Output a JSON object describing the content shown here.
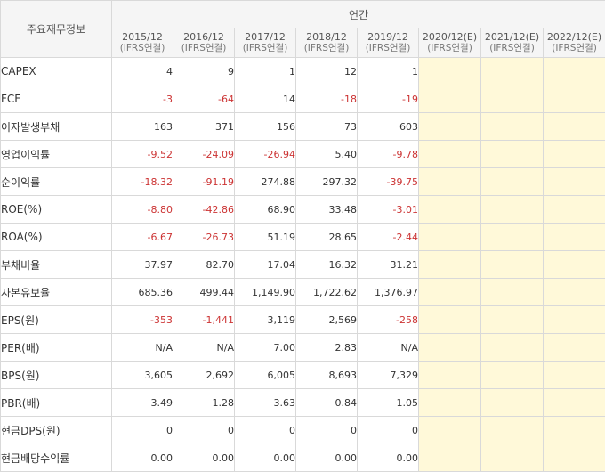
{
  "table": {
    "corner_label": "주요재무정보",
    "group_label": "연간",
    "periods": [
      {
        "year": "2015/12",
        "basis": "(IFRS연결)",
        "estimate": false
      },
      {
        "year": "2016/12",
        "basis": "(IFRS연결)",
        "estimate": false
      },
      {
        "year": "2017/12",
        "basis": "(IFRS연결)",
        "estimate": false
      },
      {
        "year": "2018/12",
        "basis": "(IFRS연결)",
        "estimate": false
      },
      {
        "year": "2019/12",
        "basis": "(IFRS연결)",
        "estimate": false
      },
      {
        "year": "2020/12(E)",
        "basis": "(IFRS연결)",
        "estimate": true
      },
      {
        "year": "2021/12(E)",
        "basis": "(IFRS연결)",
        "estimate": true
      },
      {
        "year": "2022/12(E)",
        "basis": "(IFRS연결)",
        "estimate": true
      }
    ],
    "rows": [
      {
        "label": "CAPEX",
        "values": [
          "4",
          "9",
          "1",
          "12",
          "1",
          "",
          "",
          ""
        ]
      },
      {
        "label": "FCF",
        "values": [
          "-3",
          "-64",
          "14",
          "-18",
          "-19",
          "",
          "",
          ""
        ]
      },
      {
        "label": "이자발생부채",
        "values": [
          "163",
          "371",
          "156",
          "73",
          "603",
          "",
          "",
          ""
        ]
      },
      {
        "label": "영업이익률",
        "values": [
          "-9.52",
          "-24.09",
          "-26.94",
          "5.40",
          "-9.78",
          "",
          "",
          ""
        ]
      },
      {
        "label": "순이익률",
        "values": [
          "-18.32",
          "-91.19",
          "274.88",
          "297.32",
          "-39.75",
          "",
          "",
          ""
        ]
      },
      {
        "label": "ROE(%)",
        "values": [
          "-8.80",
          "-42.86",
          "68.90",
          "33.48",
          "-3.01",
          "",
          "",
          ""
        ]
      },
      {
        "label": "ROA(%)",
        "values": [
          "-6.67",
          "-26.73",
          "51.19",
          "28.65",
          "-2.44",
          "",
          "",
          ""
        ]
      },
      {
        "label": "부채비율",
        "values": [
          "37.97",
          "82.70",
          "17.04",
          "16.32",
          "31.21",
          "",
          "",
          ""
        ]
      },
      {
        "label": "자본유보율",
        "values": [
          "685.36",
          "499.44",
          "1,149.90",
          "1,722.62",
          "1,376.97",
          "",
          "",
          ""
        ]
      },
      {
        "label": "EPS(원)",
        "values": [
          "-353",
          "-1,441",
          "3,119",
          "2,569",
          "-258",
          "",
          "",
          ""
        ]
      },
      {
        "label": "PER(배)",
        "values": [
          "N/A",
          "N/A",
          "7.00",
          "2.83",
          "N/A",
          "",
          "",
          ""
        ]
      },
      {
        "label": "BPS(원)",
        "values": [
          "3,605",
          "2,692",
          "6,005",
          "8,693",
          "7,329",
          "",
          "",
          ""
        ]
      },
      {
        "label": "PBR(배)",
        "values": [
          "3.49",
          "1.28",
          "3.63",
          "0.84",
          "1.05",
          "",
          "",
          ""
        ]
      },
      {
        "label": "현금DPS(원)",
        "values": [
          "0",
          "0",
          "0",
          "0",
          "0",
          "",
          "",
          ""
        ]
      },
      {
        "label": "현금배당수익률",
        "values": [
          "0.00",
          "0.00",
          "0.00",
          "0.00",
          "0.00",
          "",
          "",
          ""
        ]
      }
    ]
  },
  "colors": {
    "negative": "#cc3333",
    "estimate_bg": "#fff9d9",
    "header_bg": "#f5f5f5",
    "border": "#d9d9d9"
  }
}
